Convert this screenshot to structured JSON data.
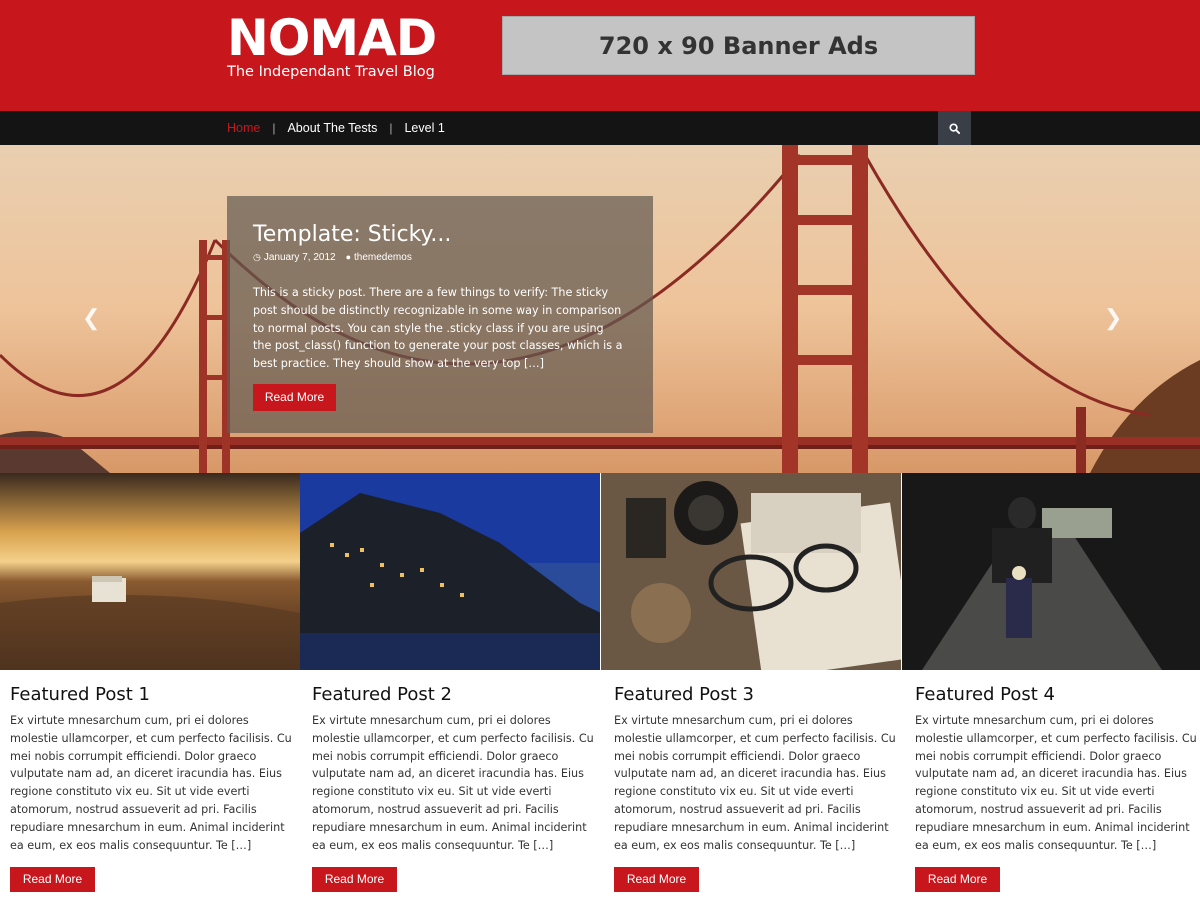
{
  "site": {
    "title": "NOMAD",
    "tagline": "The Independant Travel Blog",
    "banner_ad": "720 x 90 Banner Ads"
  },
  "nav": {
    "items": [
      {
        "label": "Home",
        "active": true
      },
      {
        "label": "About The Tests",
        "active": false
      },
      {
        "label": "Level 1",
        "active": false
      }
    ],
    "search_icon": "search-icon"
  },
  "hero": {
    "title": "Template: Sticky...",
    "date": "January 7, 2012",
    "author": "themedemos",
    "excerpt": "This is a sticky post. There are a few things to verify: The sticky post should be distinctly recognizable in some way in comparison to normal posts. You can style the .sticky class if you are using the post_class() function to generate your post classes, which is a best practice. They should show at the very top […]",
    "read_more": "Read More",
    "prev_icon": "chevron-left-icon",
    "next_icon": "chevron-right-icon"
  },
  "featured": [
    {
      "title": "Featured Post 1",
      "excerpt": "Ex virtute mnesarchum cum, pri ei dolores molestie ullamcorper, et cum perfecto facilisis. Cu mei nobis corrumpit efficiendi. Dolor graeco vulputate nam ad, an diceret iracundia has. Eius regione constituto vix eu. Sit ut vide everti atomorum, nostrud assueverit ad pri. Facilis repudiare mnesarchum in eum. Animal inciderint ea eum, ex eos malis consequuntur. Te […]",
      "read_more": "Read More"
    },
    {
      "title": "Featured Post 2",
      "excerpt": "Ex virtute mnesarchum cum, pri ei dolores molestie ullamcorper, et cum perfecto facilisis. Cu mei nobis corrumpit efficiendi. Dolor graeco vulputate nam ad, an diceret iracundia has. Eius regione constituto vix eu. Sit ut vide everti atomorum, nostrud assueverit ad pri. Facilis repudiare mnesarchum in eum. Animal inciderint ea eum, ex eos malis consequuntur. Te […]",
      "read_more": "Read More"
    },
    {
      "title": "Featured Post 3",
      "excerpt": "Ex virtute mnesarchum cum, pri ei dolores molestie ullamcorper, et cum perfecto facilisis. Cu mei nobis corrumpit efficiendi. Dolor graeco vulputate nam ad, an diceret iracundia has. Eius regione constituto vix eu. Sit ut vide everti atomorum, nostrud assueverit ad pri. Facilis repudiare mnesarchum in eum. Animal inciderint ea eum, ex eos malis consequuntur. Te […]",
      "read_more": "Read More"
    },
    {
      "title": "Featured Post 4",
      "excerpt": "Ex virtute mnesarchum cum, pri ei dolores molestie ullamcorper, et cum perfecto facilisis. Cu mei nobis corrumpit efficiendi. Dolor graeco vulputate nam ad, an diceret iracundia has. Eius regione constituto vix eu. Sit ut vide everti atomorum, nostrud assueverit ad pri. Facilis repudiare mnesarchum in eum. Animal inciderint ea eum, ex eos malis consequuntur. Te […]",
      "read_more": "Read More"
    }
  ],
  "colors": {
    "brand_red": "#c8161d",
    "nav_bg": "#141414",
    "search_bg": "#3a3f47"
  }
}
